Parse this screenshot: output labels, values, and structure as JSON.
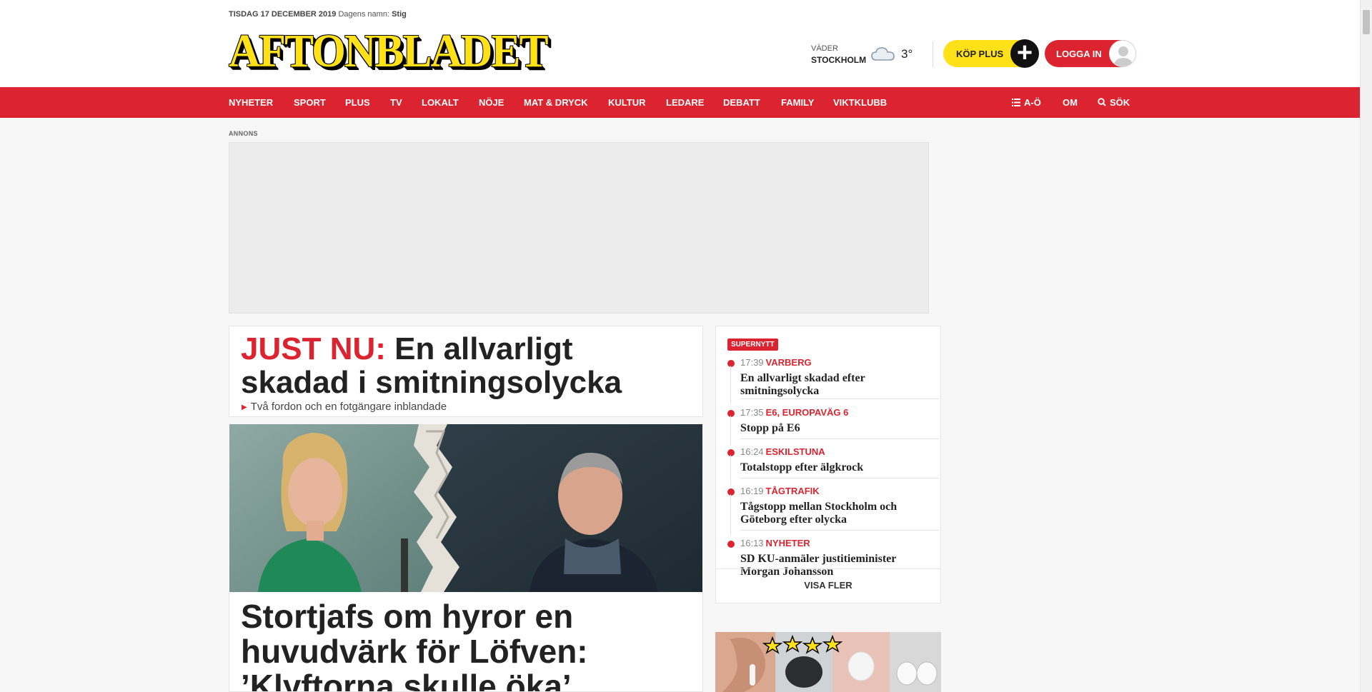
{
  "header": {
    "date": "TISDAG 17 DECEMBER 2019",
    "namesday_label": "Dagens namn:",
    "namesday_name": "Stig",
    "logo": "AFTONBLADET",
    "weather_label": "VÄDER",
    "weather_city": "STOCKHOLM",
    "weather_temp": "3°",
    "buy_plus_label": "KÖP PLUS",
    "login_label": "LOGGA IN"
  },
  "nav": {
    "items": [
      {
        "label": "NYHETER"
      },
      {
        "label": "SPORT"
      },
      {
        "label": "PLUS"
      },
      {
        "label": "TV"
      },
      {
        "label": "LOKALT"
      },
      {
        "label": "NÖJE"
      },
      {
        "label": "MAT & DRYCK"
      },
      {
        "label": "KULTUR"
      },
      {
        "label": "LEDARE"
      },
      {
        "label": "DEBATT"
      },
      {
        "label": "FAMILY"
      },
      {
        "label": "VIKTKLUBB"
      }
    ],
    "az_label": "A-Ö",
    "om_label": "OM",
    "search_label": "SÖK"
  },
  "ad": {
    "label": "ANNONS"
  },
  "lead_story": {
    "kicker": "JUST NU:",
    "headline": "En allvarligt skadad i smitningsolycka",
    "subline": "Två fordon och en fotgängare inblandade"
  },
  "main_story": {
    "headline": "Stortjafs om hyror en huvudvärk för Löfven: ’Klyftorna skulle öka’"
  },
  "supernytt": {
    "badge": "SUPERNYTT",
    "items": [
      {
        "time": "17:39",
        "category": "VARBERG",
        "title": "En allvarligt skadad efter smitningsolycka"
      },
      {
        "time": "17:35",
        "category": "E6, EUROPAVÄG 6",
        "title": "Stopp på E6"
      },
      {
        "time": "16:24",
        "category": "ESKILSTUNA",
        "title": "Totalstopp efter älgkrock"
      },
      {
        "time": "16:19",
        "category": "TÅGTRAFIK",
        "title": "Tågstopp mellan Stockholm och Göteborg efter olycka"
      },
      {
        "time": "16:13",
        "category": "NYHETER",
        "title": "SD KU-anmäler justitieminister Morgan Johansson"
      }
    ],
    "more_label": "VISA FLER"
  },
  "colors": {
    "brand_red": "#dc2430",
    "brand_yellow": "#ffe11a"
  }
}
